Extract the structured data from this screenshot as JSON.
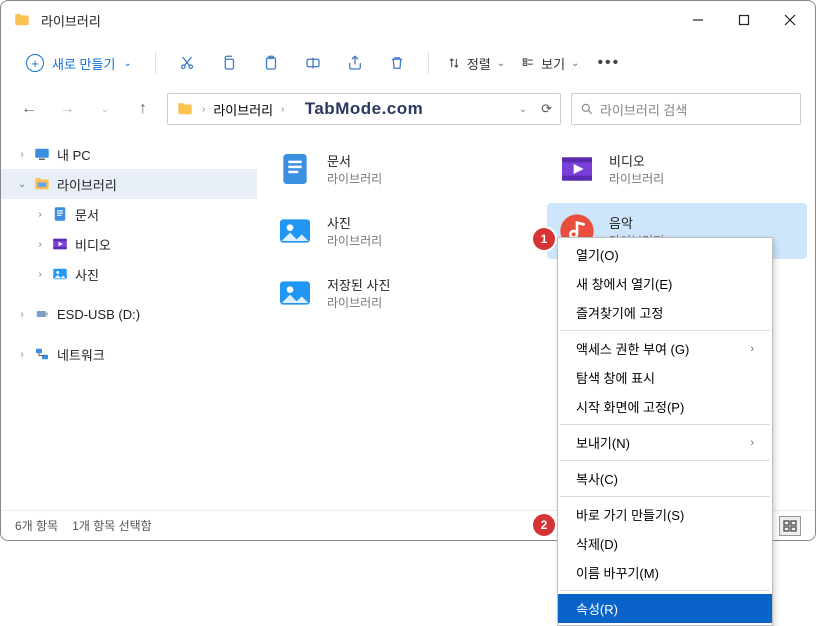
{
  "window": {
    "title": "라이브러리"
  },
  "toolbar": {
    "new_label": "새로 만들기",
    "sort_label": "정렬",
    "view_label": "보기"
  },
  "nav": {
    "address": "라이브러리",
    "search_placeholder": "라이브러리 검색",
    "watermark": "TabMode.com"
  },
  "sidebar": [
    {
      "label": "내 PC",
      "caret": "›",
      "icon": "pc"
    },
    {
      "label": "라이브러리",
      "caret": "⌄",
      "icon": "libs",
      "selected": true
    },
    {
      "label": "문서",
      "caret": "›",
      "icon": "doc",
      "indent": true
    },
    {
      "label": "비디오",
      "caret": "›",
      "icon": "video",
      "indent": true
    },
    {
      "label": "사진",
      "caret": "›",
      "icon": "photo",
      "indent": true
    },
    {
      "spacer": true
    },
    {
      "label": "ESD-USB (D:)",
      "caret": "›",
      "icon": "usb"
    },
    {
      "spacer": true
    },
    {
      "label": "네트워크",
      "caret": "›",
      "icon": "net"
    }
  ],
  "items": [
    {
      "title": "문서",
      "sub": "라이브러리",
      "icon": "doc"
    },
    {
      "title": "비디오",
      "sub": "라이브러리",
      "icon": "video"
    },
    {
      "title": "사진",
      "sub": "라이브러리",
      "icon": "photo"
    },
    {
      "title": "음악",
      "sub": "라이브러리",
      "icon": "music",
      "selected": true
    },
    {
      "title": "저장된 사진",
      "sub": "라이브러리",
      "icon": "photo"
    }
  ],
  "context_menu": [
    {
      "label": "열기(O)"
    },
    {
      "label": "새 창에서 열기(E)"
    },
    {
      "label": "즐겨찾기에 고정"
    },
    {
      "sep": true
    },
    {
      "label": "액세스 권한 부여 (G)",
      "submenu": true
    },
    {
      "label": "탐색 창에 표시"
    },
    {
      "label": "시작 화면에 고정(P)"
    },
    {
      "sep": true
    },
    {
      "label": "보내기(N)",
      "submenu": true
    },
    {
      "sep": true
    },
    {
      "label": "복사(C)"
    },
    {
      "sep": true
    },
    {
      "label": "바로 가기 만들기(S)"
    },
    {
      "label": "삭제(D)"
    },
    {
      "label": "이름 바꾸기(M)"
    },
    {
      "sep": true
    },
    {
      "label": "속성(R)",
      "highlight": true
    }
  ],
  "status": {
    "count": "6개 항목",
    "selected": "1개 항목 선택함"
  },
  "badges": {
    "b1": "1",
    "b2": "2"
  }
}
